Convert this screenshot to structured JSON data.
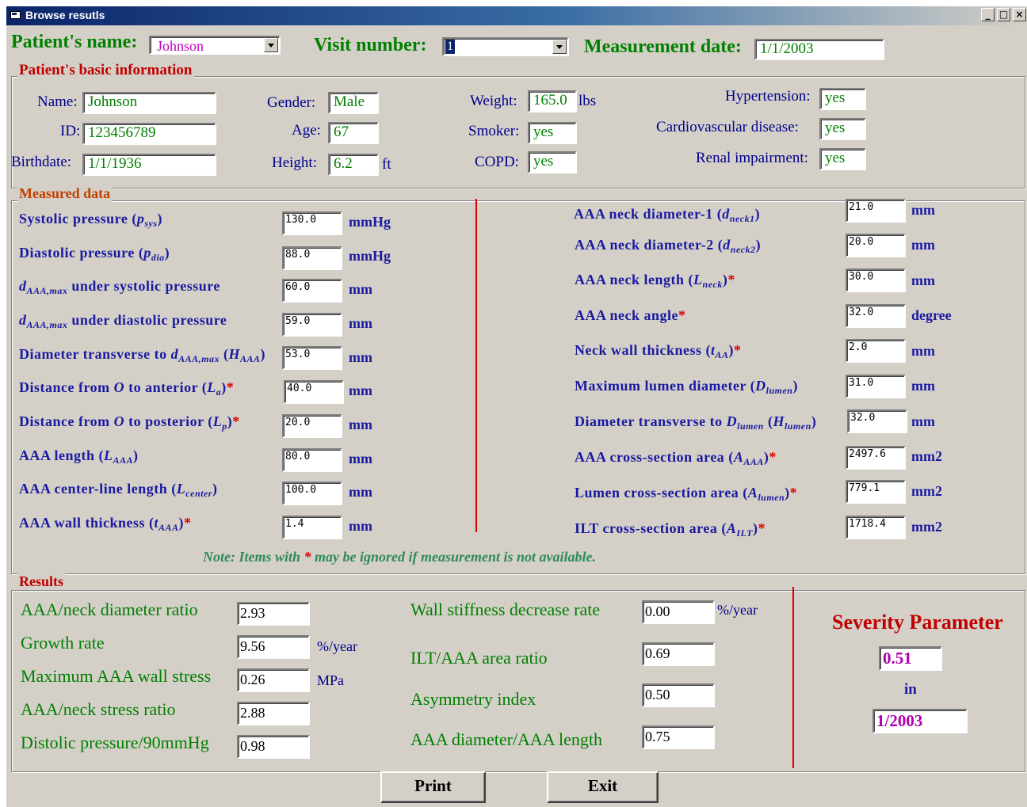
{
  "window": {
    "title": "Browse resutls",
    "controls": [
      "_",
      "□",
      "×"
    ]
  },
  "header": {
    "patient_name_label": "Patient's name:",
    "patient_name_value": "Johnson",
    "visit_label": "Visit number:",
    "visit_value": "1",
    "date_label": "Measurement date:",
    "date_value": "1/1/2003"
  },
  "basic": {
    "title": "Patient's basic information",
    "name_label": "Name:",
    "name_value": "Johnson",
    "id_label": "ID:",
    "id_value": "123456789",
    "birth_label": "Birthdate:",
    "birth_value": "1/1/1936",
    "gender_label": "Gender:",
    "gender_value": "Male",
    "age_label": "Age:",
    "age_value": "67",
    "height_label": "Height:",
    "height_value": "6.2",
    "height_unit": "ft",
    "weight_label": "Weight:",
    "weight_value": "165.0",
    "weight_unit": "lbs",
    "smoker_label": "Smoker:",
    "smoker_value": "yes",
    "copd_label": "COPD:",
    "copd_value": "yes",
    "hyper_label": "Hypertension:",
    "hyper_value": "yes",
    "cardio_label": "Cardiovascular disease:",
    "cardio_value": "yes",
    "renal_label": "Renal impairment:",
    "renal_value": "yes"
  },
  "measured": {
    "title": "Measured data",
    "left": [
      {
        "pre": "Systolic pressure (",
        "v": "p",
        "sub": "sys",
        "post": ")",
        "star": "",
        "value": "130.0",
        "unit": "mmHg"
      },
      {
        "pre": "Diastolic pressure (",
        "v": "p",
        "sub": "dia",
        "post": ")",
        "star": "",
        "value": "88.0",
        "unit": "mmHg"
      },
      {
        "pre": "",
        "v": "d",
        "sub": "AAA,max",
        "post": " under systolic pressure",
        "star": "",
        "value": "60.0",
        "unit": "mm"
      },
      {
        "pre": "",
        "v": "d",
        "sub": "AAA,max",
        "post": " under diastolic pressure",
        "star": "",
        "value": "59.0",
        "unit": "mm"
      },
      {
        "pre": "Diameter transverse to ",
        "v": "d",
        "sub": "AAA,max",
        "post": " (",
        "v2": "H",
        "sub2": "AAA",
        "post2": ")",
        "star": "",
        "value": "53.0",
        "unit": "mm"
      },
      {
        "pre": "Distance from ",
        "v": "O",
        "sub": "",
        "post": " to anterior (",
        "v2": "L",
        "sub2": "a",
        "post2": ")",
        "star": "*",
        "value": "40.0",
        "unit": "mm"
      },
      {
        "pre": "Distance from ",
        "v": "O",
        "sub": "",
        "post": " to posterior (",
        "v2": "L",
        "sub2": "p",
        "post2": ")",
        "star": "*",
        "value": "20.0",
        "unit": "mm"
      },
      {
        "pre": "AAA length (",
        "v": "L",
        "sub": "AAA",
        "post": ")",
        "star": "",
        "value": "80.0",
        "unit": "mm"
      },
      {
        "pre": "AAA center-line length (",
        "v": "L",
        "sub": "center",
        "post": ")",
        "star": "",
        "value": "100.0",
        "unit": "mm"
      },
      {
        "pre": "AAA wall thickness (",
        "v": "t",
        "sub": "AAA",
        "post": ")",
        "star": "*",
        "value": "1.4",
        "unit": "mm"
      }
    ],
    "right": [
      {
        "pre": "AAA neck diameter-1 (",
        "v": "d",
        "sub": "neck1",
        "post": ")",
        "star": "",
        "value": "21.0",
        "unit": "mm"
      },
      {
        "pre": "AAA neck diameter-2 (",
        "v": "d",
        "sub": "neck2",
        "post": ")",
        "star": "",
        "value": "20.0",
        "unit": "mm"
      },
      {
        "pre": "AAA neck length (",
        "v": "L",
        "sub": "neck",
        "post": ")",
        "star": "*",
        "value": "30.0",
        "unit": "mm"
      },
      {
        "pre": "AAA neck angle",
        "v": "",
        "sub": "",
        "post": "",
        "star": "*",
        "value": "32.0",
        "unit": "degree"
      },
      {
        "pre": "Neck wall thickness (",
        "v": "t",
        "sub": "AA",
        "post": ")",
        "star": "*",
        "value": "2.0",
        "unit": "mm"
      },
      {
        "pre": "Maximum lumen diameter (",
        "v": "D",
        "sub": "lumen",
        "post": ")",
        "star": "",
        "value": "31.0",
        "unit": "mm"
      },
      {
        "pre": "Diameter transverse to ",
        "v": "D",
        "sub": "lumen",
        "post": " (",
        "v2": "H",
        "sub2": "lumen",
        "post2": ")",
        "star": "",
        "value": "32.0",
        "unit": "mm"
      },
      {
        "pre": "AAA cross-section area (",
        "v": "A",
        "sub": "AAA",
        "post": ")",
        "star": "*",
        "value": "2497.6",
        "unit": "mm2"
      },
      {
        "pre": "Lumen cross-section area (",
        "v": "A",
        "sub": "lumen",
        "post": ")",
        "star": "*",
        "value": "779.1",
        "unit": "mm2"
      },
      {
        "pre": "ILT cross-section area (",
        "v": "A",
        "sub": "ILT",
        "post": ")",
        "star": "*",
        "value": "1718.4",
        "unit": "mm2"
      }
    ],
    "note_a": "Note: Items with ",
    "note_star": "*",
    "note_b": " may be ignored if measurement is not available."
  },
  "results": {
    "title": "Results",
    "left": [
      {
        "label": "AAA/neck diameter ratio",
        "value": "2.93",
        "unit": ""
      },
      {
        "label": "Growth rate",
        "value": "9.56",
        "unit": "%/year"
      },
      {
        "label": "Maximum AAA wall stress",
        "value": "0.26",
        "unit": "MPa"
      },
      {
        "label": "AAA/neck stress ratio",
        "value": "2.88",
        "unit": ""
      },
      {
        "label": "Distolic pressure/90mmHg",
        "value": "0.98",
        "unit": ""
      }
    ],
    "mid": [
      {
        "label": "Wall stiffness decrease rate",
        "value": "0.00",
        "unit": "%/year"
      },
      {
        "label": "ILT/AAA area ratio",
        "value": "0.69",
        "unit": ""
      },
      {
        "label": "Asymmetry index",
        "value": "0.50",
        "unit": ""
      },
      {
        "label": "AAA diameter/AAA length",
        "value": "0.75",
        "unit": ""
      }
    ],
    "severity_title": "Severity Parameter",
    "severity_value": "0.51",
    "in_label": "in",
    "severity_date": "1/2003"
  },
  "buttons": {
    "print": "Print",
    "exit": "Exit"
  }
}
